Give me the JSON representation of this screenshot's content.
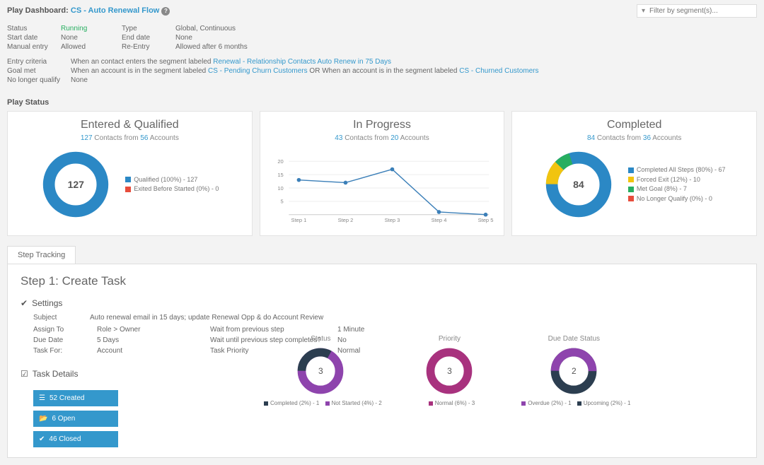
{
  "header": {
    "label": "Play Dashboard:",
    "play_name": "CS - Auto Renewal Flow",
    "search_placeholder": "Filter by segment(s)..."
  },
  "meta": {
    "status_label": "Status",
    "status_value": "Running",
    "startdate_label": "Start date",
    "startdate_value": "None",
    "manual_label": "Manual entry",
    "manual_value": "Allowed",
    "type_label": "Type",
    "type_value": "Global, Continuous",
    "enddate_label": "End date",
    "enddate_value": "None",
    "reentry_label": "Re-Entry",
    "reentry_value": "Allowed after 6 months"
  },
  "criteria": {
    "entry_label": "Entry criteria",
    "entry_prefix": "When an contact enters the segment labeled ",
    "entry_link": "Renewal - Relationship Contacts Auto Renew in 75 Days",
    "goal_label": "Goal met",
    "goal_prefix": "When an account is in the segment labeled ",
    "goal_link1": "CS - Pending Churn Customers",
    "goal_mid": " OR When an account is in the segment labeled ",
    "goal_link2": "CS - Churned Customers",
    "nolonger_label": "No longer qualify",
    "nolonger_value": "None"
  },
  "play_status_label": "Play Status",
  "cards": {
    "entered": {
      "title": "Entered & Qualified",
      "count": "127",
      "count_label": "Contacts from",
      "accounts": "56",
      "accounts_label": "Accounts",
      "center": "127",
      "legend": [
        {
          "color": "#2b88c5",
          "label": "Qualified (100%) - 127"
        },
        {
          "color": "#e74c3c",
          "label": "Exited Before Started (0%) - 0"
        }
      ]
    },
    "inprogress": {
      "title": "In Progress",
      "count": "43",
      "count_label": "Contacts from",
      "accounts": "20",
      "accounts_label": "Accounts"
    },
    "completed": {
      "title": "Completed",
      "count": "84",
      "count_label": "Contacts from",
      "accounts": "36",
      "accounts_label": "Accounts",
      "center": "84",
      "legend": [
        {
          "color": "#2b88c5",
          "label": "Completed All Steps (80%) - 67"
        },
        {
          "color": "#f1c40f",
          "label": "Forced Exit (12%) - 10"
        },
        {
          "color": "#27ae60",
          "label": "Met Goal (8%) - 7"
        },
        {
          "color": "#e74c3c",
          "label": "No Longer Qualify (0%) - 0"
        }
      ]
    }
  },
  "chart_data": {
    "type": "line",
    "title": "In Progress",
    "categories": [
      "Step 1",
      "Step 2",
      "Step 3",
      "Step 4",
      "Step 5"
    ],
    "values": [
      13,
      12,
      17,
      1,
      0
    ],
    "ylim": [
      0,
      20
    ],
    "yticks": [
      5,
      10,
      15,
      20
    ]
  },
  "tab_label": "Step Tracking",
  "step": {
    "title": "Step 1: Create Task",
    "settings_label": "Settings",
    "subject_label": "Subject",
    "subject_value": "Auto renewal email in 15 days; update Renewal Opp & do Account Review",
    "assign_label": "Assign To",
    "assign_value": "Role > Owner",
    "due_label": "Due Date",
    "due_value": "5 Days",
    "taskfor_label": "Task For:",
    "taskfor_value": "Account",
    "wait_label": "Wait from previous step",
    "wait_value": "1 Minute",
    "waituntil_label": "Wait until previous step completes?",
    "waituntil_value": "No",
    "priority_label": "Task Priority",
    "priority_value": "Normal",
    "details_label": "Task Details",
    "buttons": {
      "created": "52 Created",
      "open": "6 Open",
      "closed": "46 Closed"
    },
    "mini": {
      "status": {
        "title": "Status",
        "center": "3",
        "legend": [
          {
            "color": "#2c3e50",
            "label": "Completed (2%) - 1"
          },
          {
            "color": "#8e44ad",
            "label": "Not Started (4%) - 2"
          }
        ]
      },
      "priority": {
        "title": "Priority",
        "center": "3",
        "legend": [
          {
            "color": "#c0392b",
            "label": "Normal (6%) - 3"
          }
        ]
      },
      "duedate": {
        "title": "Due Date Status",
        "center": "2",
        "legend": [
          {
            "color": "#8e44ad",
            "label": "Overdue (2%) - 1"
          },
          {
            "color": "#2c3e50",
            "label": "Upcoming (2%) - 1"
          }
        ]
      }
    }
  }
}
